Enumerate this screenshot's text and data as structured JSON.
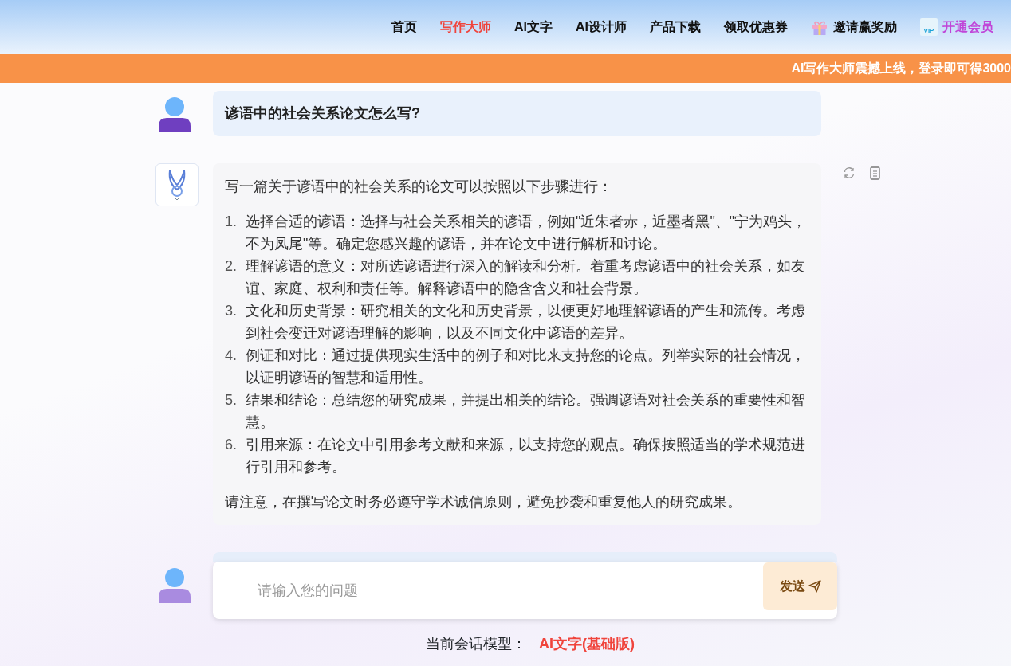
{
  "nav": [
    {
      "label": "首页",
      "selected": false,
      "kind": "plain"
    },
    {
      "label": "写作大师",
      "selected": true,
      "kind": "plain"
    },
    {
      "label": "AI文字",
      "selected": false,
      "kind": "plain"
    },
    {
      "label": "AI设计师",
      "selected": false,
      "kind": "plain"
    },
    {
      "label": "产品下载",
      "selected": false,
      "kind": "plain"
    },
    {
      "label": "领取优惠券",
      "selected": false,
      "kind": "plain"
    },
    {
      "label": "邀请赢奖励",
      "selected": false,
      "kind": "gift"
    },
    {
      "label": "开通会员",
      "selected": false,
      "kind": "vip",
      "vip_badge": "VIP"
    }
  ],
  "banner": "AI写作大师震撼上线，登录即可得3000",
  "question": "谚语中的社会关系论文怎么写?",
  "answer": {
    "intro": "写一篇关于谚语中的社会关系的论文可以按照以下步骤进行：",
    "steps": [
      {
        "number": "1.",
        "text": "选择合适的谚语：选择与社会关系相关的谚语，例如\"近朱者赤，近墨者黑\"、\"宁为鸡头，不为凤尾\"等。确定您感兴趣的谚语，并在论文中进行解析和讨论。"
      },
      {
        "number": "2.",
        "text": "理解谚语的意义：对所选谚语进行深入的解读和分析。着重考虑谚语中的社会关系，如友谊、家庭、权利和责任等。解释谚语中的隐含含义和社会背景。"
      },
      {
        "number": "3.",
        "text": "文化和历史背景：研究相关的文化和历史背景，以便更好地理解谚语的产生和流传。考虑到社会变迁对谚语理解的影响，以及不同文化中谚语的差异。"
      },
      {
        "number": "4.",
        "text": "例证和对比：通过提供现实生活中的例子和对比来支持您的论点。列举实际的社会情况，以证明谚语的智慧和适用性。"
      },
      {
        "number": "5.",
        "text": "结果和结论：总结您的研究成果，并提出相关的结论。强调谚语对社会关系的重要性和智慧。"
      },
      {
        "number": "6.",
        "text": "引用来源：在论文中引用参考文献和来源，以支持您的观点。确保按照适当的学术规范进行引用和参考。"
      }
    ],
    "note": "请注意，在撰写论文时务必遵守学术诚信原则，避免抄袭和重复他人的研究成果。"
  },
  "input": {
    "placeholder": "请输入您的问题",
    "send": "发送"
  },
  "model": {
    "label": "当前会话模型：",
    "value": "AI文字(基础版)"
  }
}
